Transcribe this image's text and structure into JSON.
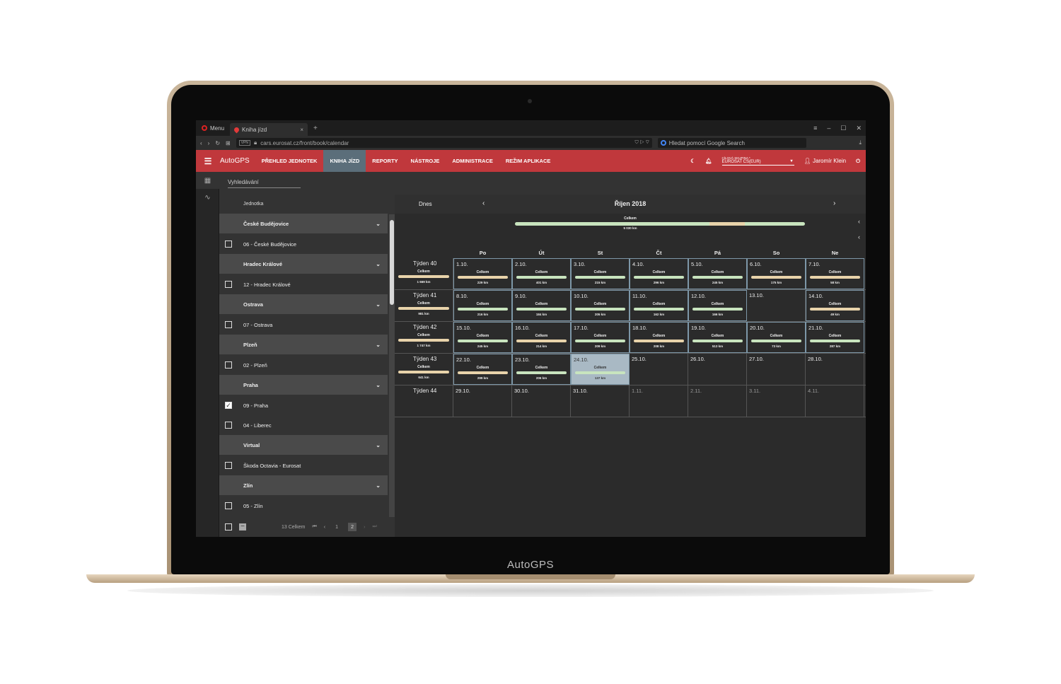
{
  "device": {
    "brand_label": "AutoGPS"
  },
  "browser": {
    "menu_label": "Menu",
    "tab_title": "Kniha jízd",
    "tab_close": "×",
    "new_tab": "+",
    "url": "cars.eurosat.cz/front/book/calendar",
    "vpn_label": "VPN",
    "search_placeholder": "Hledat pomocí Google Search"
  },
  "app": {
    "logo": "AutoGPS",
    "nav": [
      "PŘEHLED JEDNOTEK",
      "KNIHA JÍZD",
      "REPORTY",
      "NÁSTROJE",
      "ADMINISTRACE",
      "REŽIM APLIKACE"
    ],
    "active_nav": "KNIHA JÍZD",
    "group_label": "CÍLOVÁ SKUPINA *",
    "group_value": "EUROSAT CS(EUR)",
    "user": "Jaromír Klein",
    "search_placeholder": "Vyhledávání"
  },
  "units": {
    "header": "Jednotka",
    "groups": [
      {
        "name": "České Budějovice",
        "items": [
          {
            "label": "06 - České Budějovice",
            "checked": false
          }
        ]
      },
      {
        "name": "Hradec Králové",
        "items": [
          {
            "label": "12 - Hradec Králové",
            "checked": false
          }
        ]
      },
      {
        "name": "Ostrava",
        "items": [
          {
            "label": "07 - Ostrava",
            "checked": false
          }
        ]
      },
      {
        "name": "Plzeň",
        "items": [
          {
            "label": "02 - Plzeň",
            "checked": false
          }
        ]
      },
      {
        "name": "Praha",
        "items": [
          {
            "label": "09 - Praha",
            "checked": true
          },
          {
            "label": "04 - Liberec",
            "checked": false
          }
        ]
      },
      {
        "name": "Virtual",
        "items": [
          {
            "label": "Škoda Octavia - Eurosat",
            "checked": false
          }
        ]
      },
      {
        "name": "Zlín",
        "items": [
          {
            "label": "05 - Zlín",
            "checked": false
          }
        ]
      }
    ],
    "total": "13 Celkem",
    "pages": [
      "1",
      "2"
    ],
    "current_page": "2"
  },
  "calendar": {
    "today_label": "Dnes",
    "month": "Říjen 2018",
    "summary_label": "Celkem",
    "summary_value": "5 030 km",
    "weekdays": [
      "Po",
      "Út",
      "St",
      "Čt",
      "Pá",
      "So",
      "Ne"
    ],
    "item_label": "Celkem",
    "weeks": [
      {
        "label": "Týden 40",
        "total": "1 669 km",
        "days": [
          {
            "date": "1.10.",
            "km": "229 km"
          },
          {
            "date": "2.10.",
            "km": "401 km"
          },
          {
            "date": "3.10.",
            "km": "215 km"
          },
          {
            "date": "4.10.",
            "km": "296 km"
          },
          {
            "date": "5.10.",
            "km": "245 km"
          },
          {
            "date": "6.10.",
            "km": "175 km"
          },
          {
            "date": "7.10.",
            "km": "58 km"
          }
        ]
      },
      {
        "label": "Týden 41",
        "total": "981 km",
        "days": [
          {
            "date": "8.10.",
            "km": "216 km"
          },
          {
            "date": "9.10.",
            "km": "184 km"
          },
          {
            "date": "10.10.",
            "km": "205 km"
          },
          {
            "date": "11.10.",
            "km": "162 km"
          },
          {
            "date": "12.10.",
            "km": "166 km"
          },
          {
            "date": "13.10.",
            "km": ""
          },
          {
            "date": "14.10.",
            "km": "49 km"
          }
        ]
      },
      {
        "label": "Týden 42",
        "total": "1 747 km",
        "days": [
          {
            "date": "15.10.",
            "km": "245 km"
          },
          {
            "date": "16.10.",
            "km": "214 km"
          },
          {
            "date": "17.10.",
            "km": "209 km"
          },
          {
            "date": "18.10.",
            "km": "208 km"
          },
          {
            "date": "19.10.",
            "km": "513 km"
          },
          {
            "date": "20.10.",
            "km": "73 km"
          },
          {
            "date": "21.10.",
            "km": "287 km"
          }
        ]
      },
      {
        "label": "Týden 43",
        "total": "641 km",
        "days": [
          {
            "date": "22.10.",
            "km": "299 km"
          },
          {
            "date": "23.10.",
            "km": "206 km"
          },
          {
            "date": "24.10.",
            "km": "137 km",
            "today": true
          },
          {
            "date": "25.10.",
            "km": ""
          },
          {
            "date": "26.10.",
            "km": ""
          },
          {
            "date": "27.10.",
            "km": ""
          },
          {
            "date": "28.10.",
            "km": ""
          }
        ]
      },
      {
        "label": "Týden 44",
        "total": "",
        "days": [
          {
            "date": "29.10.",
            "km": ""
          },
          {
            "date": "30.10.",
            "km": ""
          },
          {
            "date": "31.10.",
            "km": ""
          },
          {
            "date": "1.11.",
            "km": "",
            "other": true
          },
          {
            "date": "2.11.",
            "km": "",
            "other": true
          },
          {
            "date": "3.11.",
            "km": "",
            "other": true
          },
          {
            "date": "4.11.",
            "km": "",
            "other": true
          }
        ]
      }
    ]
  },
  "colors": {
    "brand_red": "#c0383c",
    "active_tab": "#5b6e7a",
    "bar_green": "#c8e4be",
    "bar_warm": "#e8d3aa"
  }
}
